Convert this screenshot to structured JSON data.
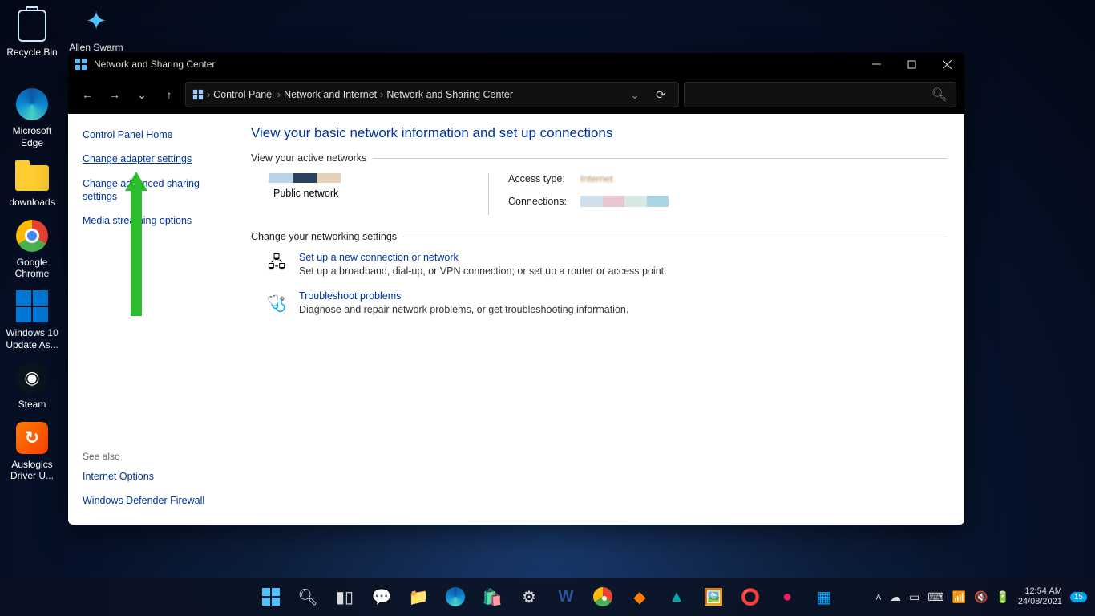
{
  "desktop_icons": {
    "recycle": "Recycle Bin",
    "alien": "Alien Swarm",
    "edge": "Microsoft Edge",
    "downloads": "downloads",
    "chrome": "Google Chrome",
    "winup": "Windows 10 Update As...",
    "steam": "Steam",
    "auslogics": "Auslogics Driver U..."
  },
  "window": {
    "title": "Network and Sharing Center",
    "breadcrumb": {
      "root": "Control Panel",
      "mid": "Network and Internet",
      "leaf": "Network and Sharing Center"
    }
  },
  "sidebar": {
    "home": "Control Panel Home",
    "adapter": "Change adapter settings",
    "sharing": "Change advanced sharing settings",
    "media": "Media streaming options",
    "seealso": "See also",
    "inetopt": "Internet Options",
    "firewall": "Windows Defender Firewall"
  },
  "main": {
    "heading": "View your basic network information and set up connections",
    "active_hdr": "View your active networks",
    "net_type": "Public network",
    "access_label": "Access type:",
    "access_value": "Internet",
    "conn_label": "Connections:",
    "change_hdr": "Change your networking settings",
    "setup_title": "Set up a new connection or network",
    "setup_desc": "Set up a broadband, dial-up, or VPN connection; or set up a router or access point.",
    "trouble_title": "Troubleshoot problems",
    "trouble_desc": "Diagnose and repair network problems, or get troubleshooting information."
  },
  "tray": {
    "time": "12:54 AM",
    "date": "24/08/2021",
    "badge": "15"
  }
}
